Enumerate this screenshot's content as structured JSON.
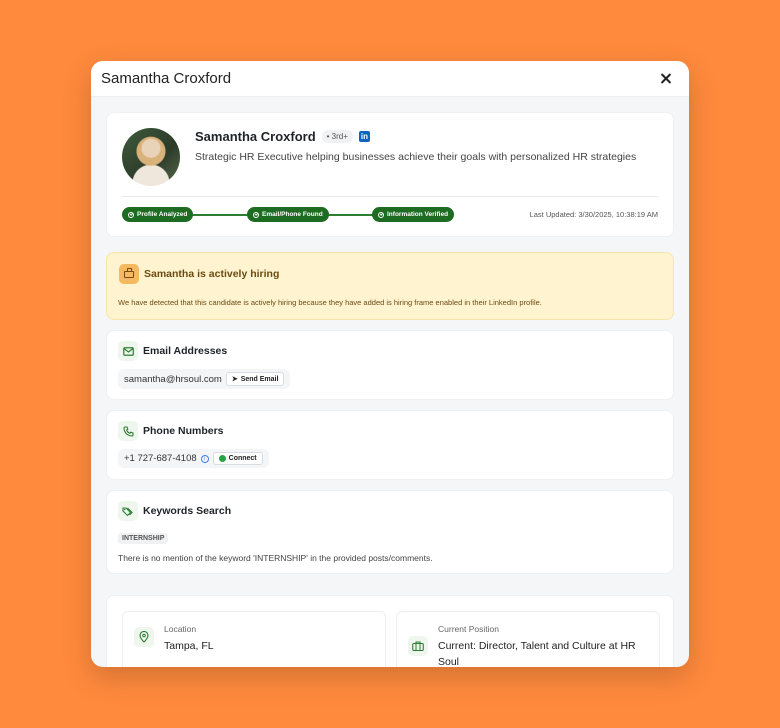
{
  "modal": {
    "title": "Samantha Croxford"
  },
  "profile": {
    "name": "Samantha Croxford",
    "degree": "• 3rd+",
    "linkedin_label": "in",
    "headline": "Strategic HR Executive helping businesses achieve their goals with personalized HR strategies",
    "steps": [
      "Profile Analyzed",
      "Email/Phone Found",
      "Information Verified"
    ],
    "last_updated": "Last Updated: 3/30/2025, 10:38:19 AM"
  },
  "hiring": {
    "title": "Samantha is actively hiring",
    "description": "We have detected that this candidate is actively hiring because they have added is hiring frame enabled in their LinkedIn profile."
  },
  "email": {
    "title": "Email Addresses",
    "address": "samantha@hrsoul.com",
    "send_label": "Send Email"
  },
  "phone": {
    "title": "Phone Numbers",
    "number": "+1 727-687-4108",
    "connect_label": "Connect"
  },
  "keywords": {
    "title": "Keywords Search",
    "keyword": "INTERNSHIP",
    "note": "There is no mention of the keyword 'INTERNSHIP' in the provided posts/comments."
  },
  "details": {
    "location_label": "Location",
    "location_value": "Tampa, FL",
    "position_label": "Current Position",
    "position_value": "Current: Director, Talent and Culture at HR Soul"
  },
  "colors": {
    "background": "#ff8a3d",
    "success": "#1e6b22",
    "hiring_bg": "#fff4cf",
    "linkedin": "#0a66c2"
  },
  "icons": {
    "close": "close-icon",
    "hiring": "briefcase-icon",
    "email": "mail-icon",
    "phone": "phone-icon",
    "keywords": "tags-icon",
    "location": "map-pin-icon",
    "position": "briefcase-icon"
  }
}
